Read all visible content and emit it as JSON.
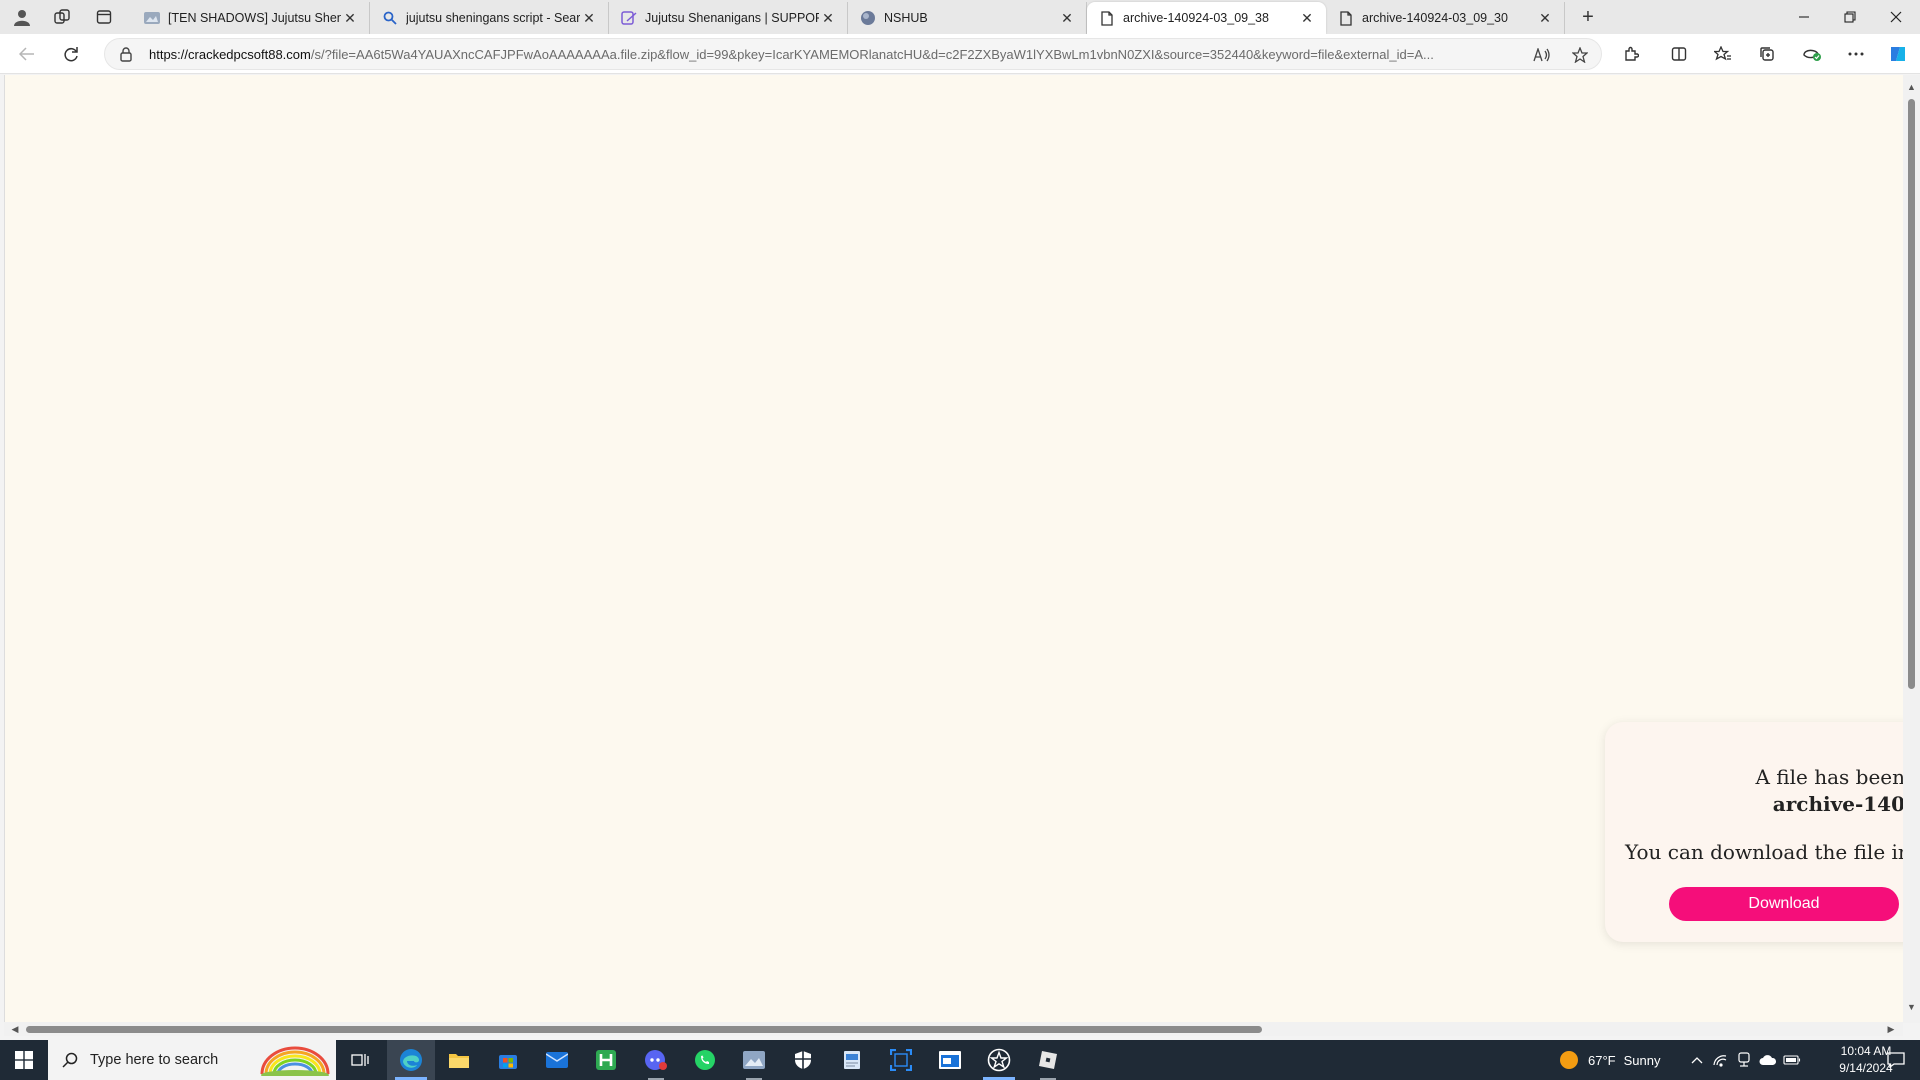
{
  "browser": {
    "tabs": [
      {
        "title": "[TEN SHADOWS] Jujutsu Shenanigans",
        "icon": "page-thumbnail-icon",
        "active": false
      },
      {
        "title": "jujutsu sheningans script - Search",
        "icon": "search-icon",
        "active": false
      },
      {
        "title": "Jujutsu Shenanigans | SUPPORTED",
        "icon": "edit-pen-icon",
        "active": false
      },
      {
        "title": "NSHUB",
        "icon": "globe-icon",
        "active": false
      },
      {
        "title": "archive-140924-03_09_38",
        "icon": "document-icon",
        "active": true
      },
      {
        "title": "archive-140924-03_09_30",
        "icon": "document-icon",
        "active": false
      }
    ],
    "new_tab_label": "+",
    "url_host": "https://crackedpcsoft88.com",
    "url_rest": "/s/?file=AA6t5Wa4YAUAXncCAFJPFwAoAAAAAAAa.file.zip&flow_id=99&pkey=IcarKYAMEMORlanatcHU&d=c2F2ZXByaW1lYXBwLm1vbnN0ZXI&source=352440&keyword=file&external_id=A..."
  },
  "page": {
    "notice_line1": "A file has been",
    "notice_filename": "archive-140",
    "notice_line3": "You can download the file in t",
    "download_label": "Download",
    "accent_color": "#f50e7a",
    "background_color": "#fdf9ef"
  },
  "taskbar": {
    "search_placeholder": "Type here to search",
    "weather_temp": "67°F",
    "weather_desc": "Sunny",
    "time": "10:04 AM",
    "date": "9/14/2024",
    "pinned": [
      "task-view-icon",
      "edge-icon",
      "file-explorer-icon",
      "store-icon",
      "mail-icon",
      "h-app-icon",
      "discord-icon",
      "whatsapp-icon",
      "photo-app-icon",
      "security-shield-icon",
      "document-app-icon",
      "snip-tool-icon",
      "window-app-icon",
      "star-app-icon",
      "roblox-icon"
    ]
  }
}
